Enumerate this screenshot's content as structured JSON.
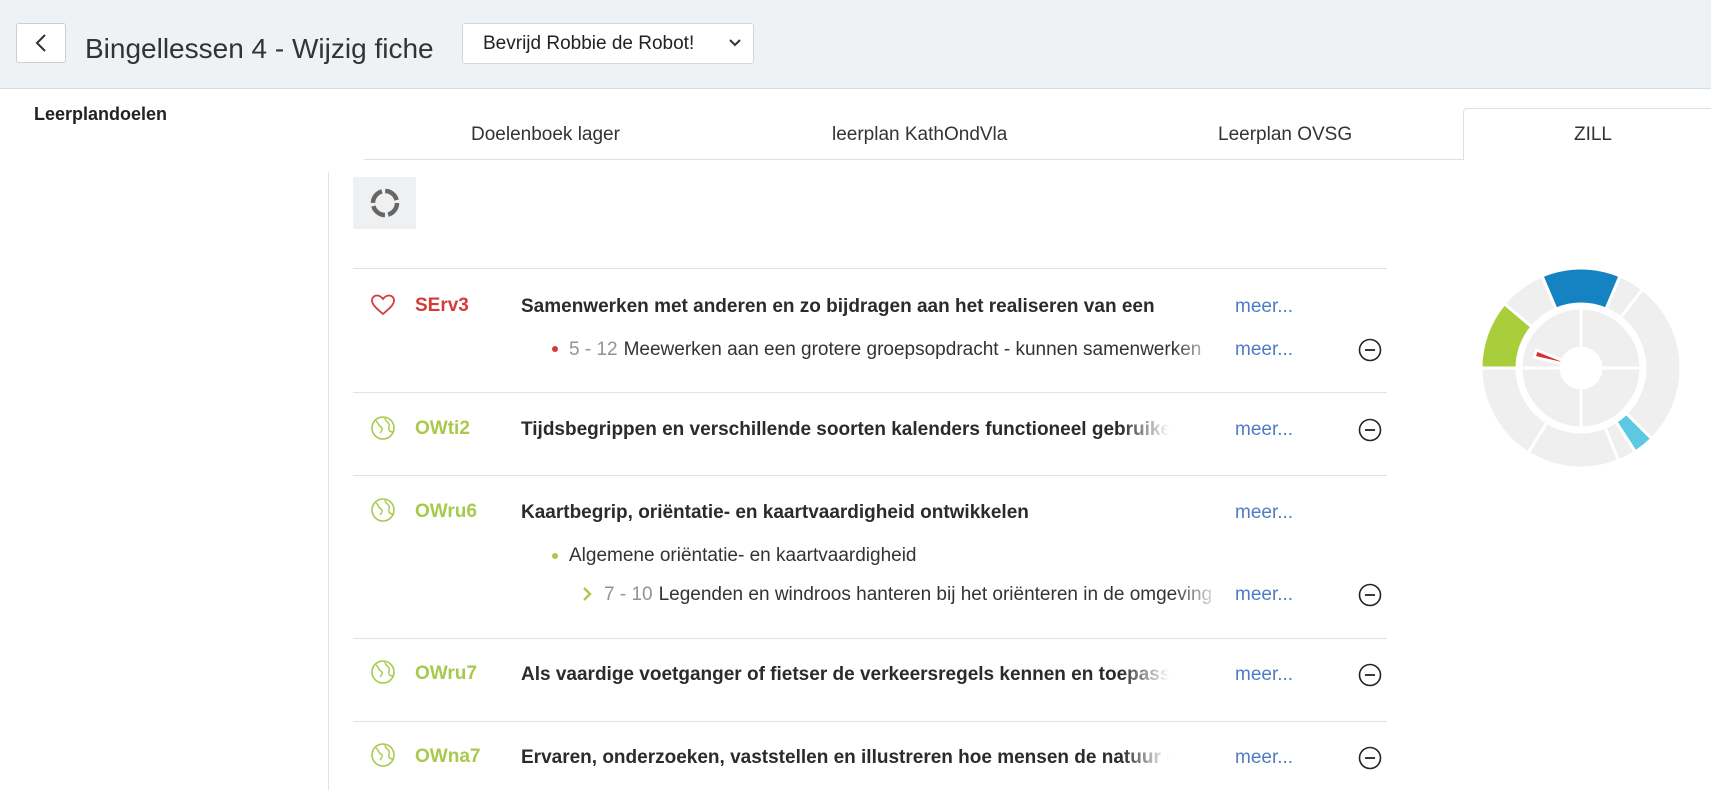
{
  "header": {
    "title": "Bingellessen 4 - Wijzig fiche",
    "fiche_select": "Bevrijd Robbie de Robot!"
  },
  "sidebar": {
    "title": "Leerplandoelen"
  },
  "tabs": [
    {
      "label": "Doelenboek lager",
      "active": false
    },
    {
      "label": "leerplan KathOndVla",
      "active": false
    },
    {
      "label": "Leerplan OVSG",
      "active": false
    },
    {
      "label": "ZILL",
      "active": true
    }
  ],
  "goals": [
    {
      "icon": "heart-icon",
      "code": "SErv3",
      "code_color": "#d63b3b",
      "title": "Samenwerken met anderen en zo bijdragen aan het realiseren van een",
      "more": "meer...",
      "subs": [
        {
          "age": "5 - 12",
          "text": "Meewerken aan een grotere groepsopdracht - kunnen samenwerken",
          "more": "meer..."
        }
      ]
    },
    {
      "icon": "globe-icon",
      "code": "OWti2",
      "code_color": "#a9c94c",
      "title": "Tijdsbegrippen en verschillende soorten kalenders functioneel gebruiken",
      "more": "meer..."
    },
    {
      "icon": "globe-icon",
      "code": "OWru6",
      "code_color": "#a9c94c",
      "title": "Kaartbegrip, oriëntatie- en kaartvaardigheid ontwikkelen",
      "more": "meer...",
      "category": "Algemene oriëntatie- en kaartvaardigheid",
      "subs": [
        {
          "age": "7 - 10",
          "text": "Legenden en windroos hanteren bij het oriënteren in de omgeving",
          "more": "meer..."
        }
      ]
    },
    {
      "icon": "globe-icon",
      "code": "OWru7",
      "code_color": "#a9c94c",
      "title": "Als vaardige voetganger of fietser de verkeersregels kennen en toepassen en",
      "more": "meer..."
    },
    {
      "icon": "globe-icon",
      "code": "OWna7",
      "code_color": "#a9c94c",
      "title": "Ervaren, onderzoeken, vaststellen en illustreren hoe mensen de natuur en hun",
      "more": "meer..."
    }
  ],
  "zill_wheel": {
    "colors": {
      "blue": "#1582c2",
      "green": "#a9ce3c",
      "red": "#d9302f",
      "cyan": "#5cc8e2",
      "grey": "#efefef"
    }
  }
}
